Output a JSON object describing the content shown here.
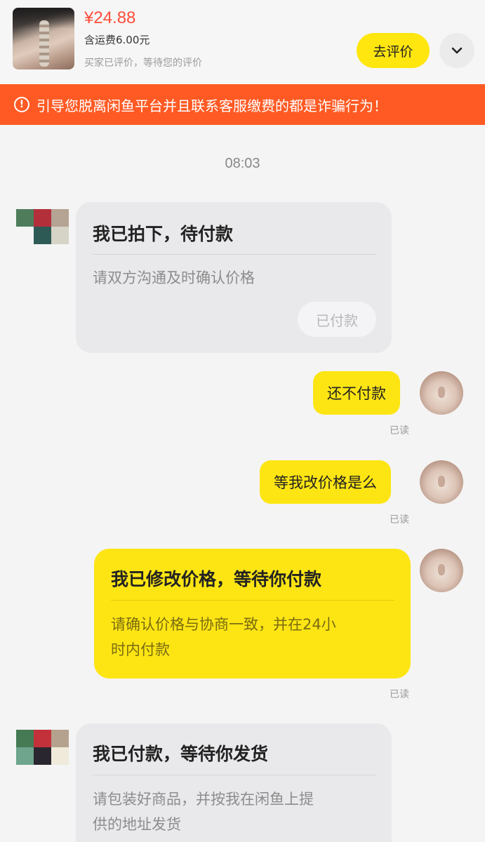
{
  "header": {
    "price": "¥24.88",
    "shipping": "含运费6.00元",
    "status": "买家已评价，等待您的评价",
    "rate_button": "去评价",
    "expand_icon": "chevron-down-icon"
  },
  "banner": {
    "icon": "exclamation-circle-icon",
    "text": "引导您脱离闲鱼平台并且联系客服缴费的都是诈骗行为！"
  },
  "chat": {
    "time": "08:03",
    "read_label": "已读",
    "card1": {
      "title": "我已拍下，待付款",
      "subtitle": "请双方沟通及时确认价格",
      "button": "已付款"
    },
    "msg1": "还不付款",
    "msg2": "等我改价格是么",
    "card2": {
      "title": "我已修改价格，等待你付款",
      "subtitle_line1": "请确认价格与协商一致，并在24小",
      "subtitle_line2": "时内付款"
    },
    "card3": {
      "title": "我已付款，等待你发货",
      "subtitle_line1": "请包装好商品，并按我在闲鱼上提",
      "subtitle_line2": "供的地址发货"
    }
  },
  "colors": {
    "accent_yellow": "#fde514",
    "price_red": "#ff4d3a",
    "banner_orange": "#ff5a24"
  }
}
